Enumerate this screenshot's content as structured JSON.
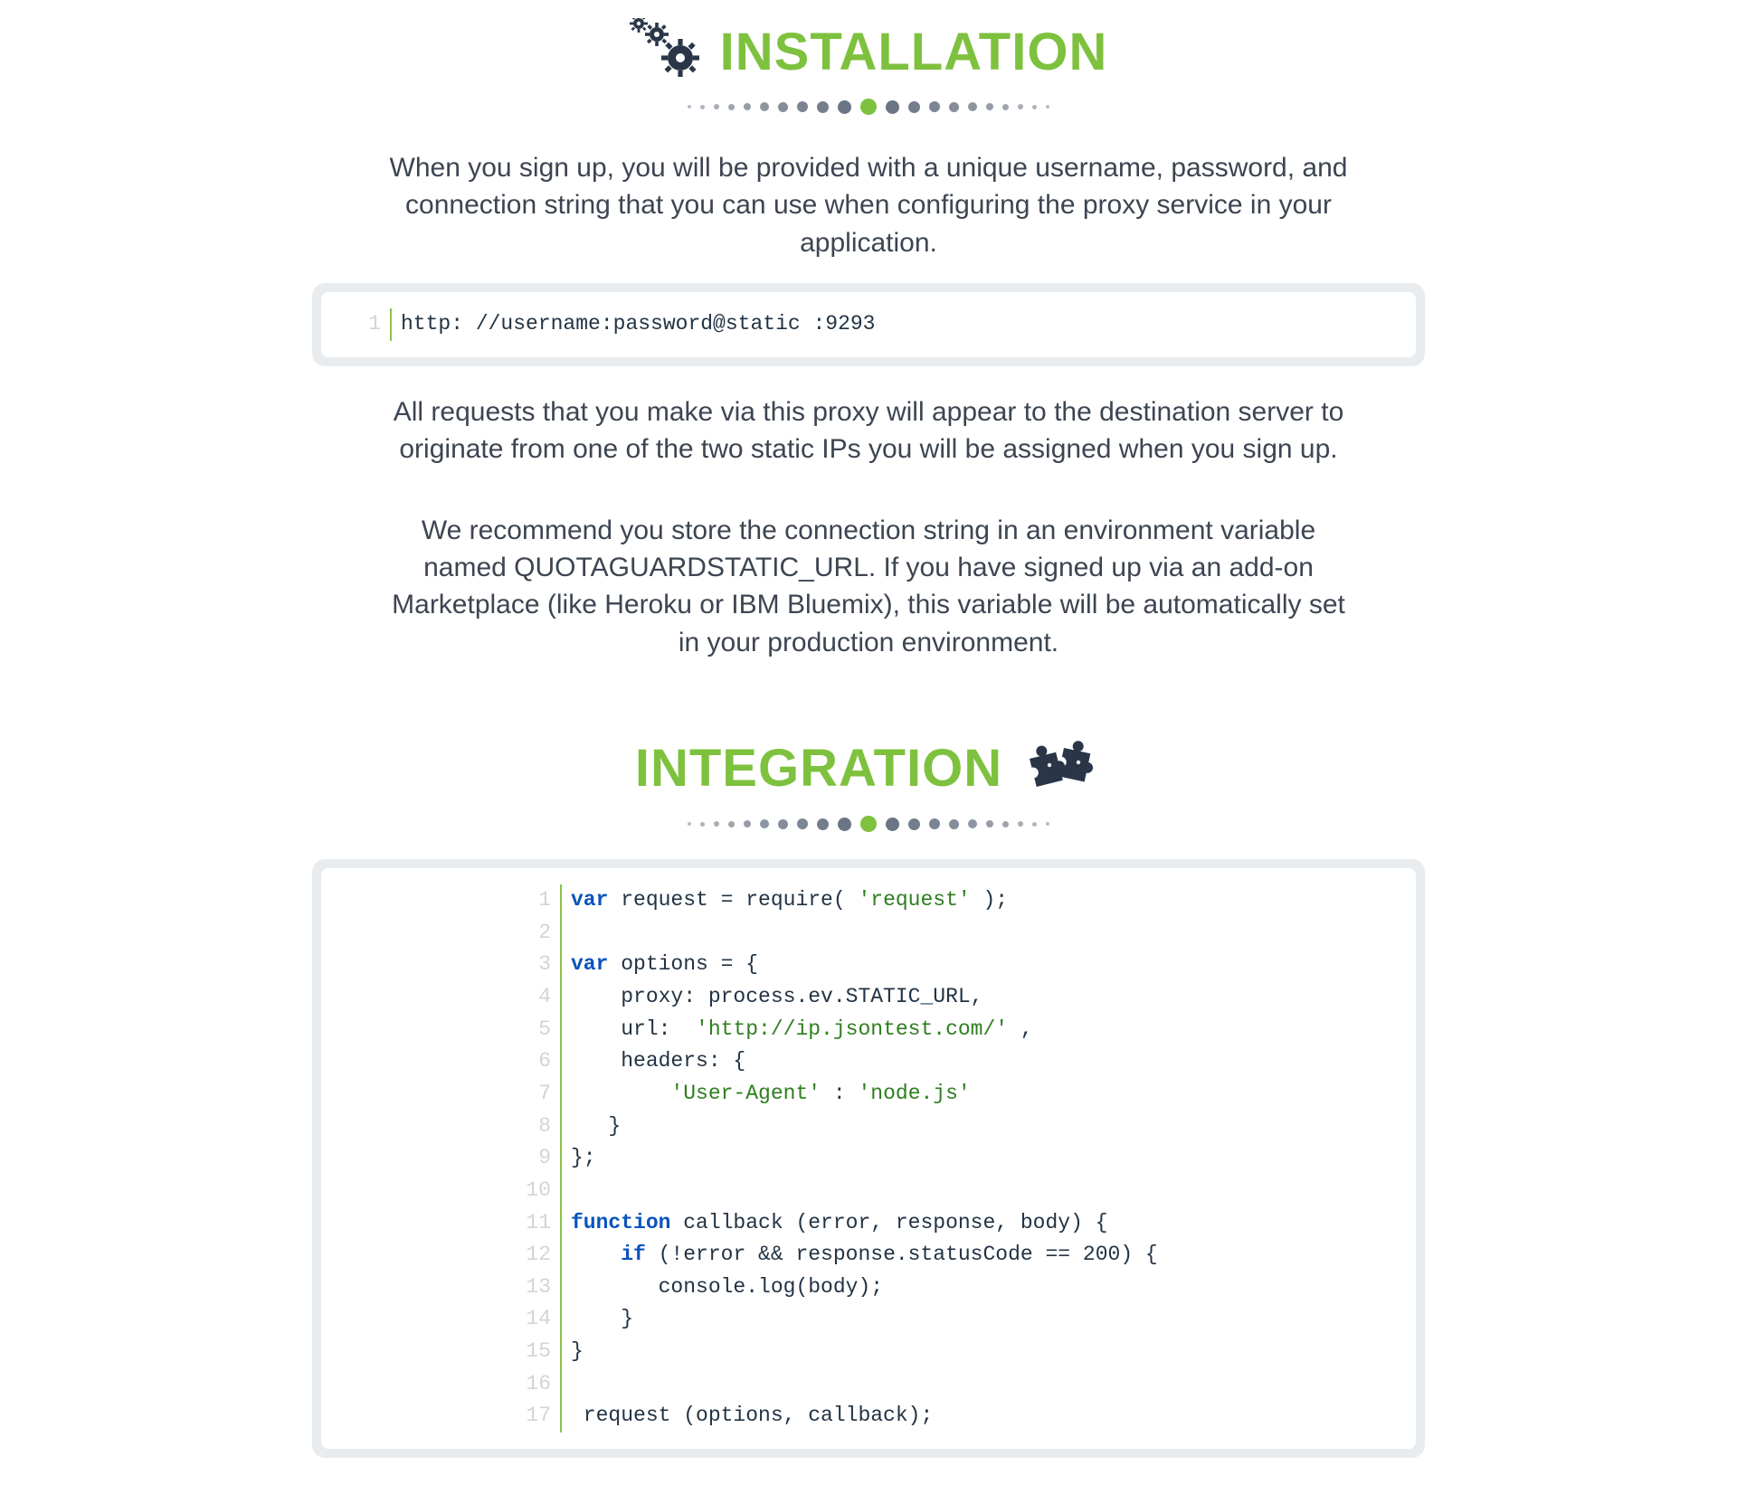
{
  "installation": {
    "title": "INSTALLATION",
    "intro": "When you sign up, you will be provided with a unique username, password, and connection string that you can use when configuring the proxy service in your application.",
    "connection_code": {
      "line_numbers": [
        "1"
      ],
      "lines": [
        "http: //username:password@static :9293"
      ]
    },
    "static_ip_text": "All requests that you make via this proxy will appear to the destination server to originate from one of the two static IPs you will be assigned when you sign up.",
    "env_var_text": "We recommend you store the connection string in an environment variable named QUOTAGUARDSTATIC_URL. If you have signed up via an add-on Marketplace (like Heroku or IBM Bluemix), this variable will be automatically set in your production environment."
  },
  "integration": {
    "title": "INTEGRATION",
    "code": {
      "line_numbers": [
        "1",
        "2",
        "3",
        "4",
        "5",
        "6",
        "7",
        "8",
        "9",
        "10",
        "11",
        "12",
        "13",
        "14",
        "15",
        "16",
        "17"
      ],
      "lines": [
        [
          {
            "t": "kw",
            "v": "var"
          },
          {
            "t": "p",
            "v": " request = require("
          },
          {
            "t": "str",
            "v": " 'request' "
          },
          {
            "t": "p",
            "v": ");"
          }
        ],
        [
          {
            "t": "p",
            "v": ""
          }
        ],
        [
          {
            "t": "kw",
            "v": "var"
          },
          {
            "t": "p",
            "v": " options = {"
          }
        ],
        [
          {
            "t": "p",
            "v": "    proxy: process.ev.STATIC_URL,"
          }
        ],
        [
          {
            "t": "p",
            "v": "    url: "
          },
          {
            "t": "str",
            "v": " 'http://ip.jsontest.com/' "
          },
          {
            "t": "p",
            "v": ","
          }
        ],
        [
          {
            "t": "p",
            "v": "    headers: {"
          }
        ],
        [
          {
            "t": "p",
            "v": "        "
          },
          {
            "t": "str",
            "v": "'User-Agent'"
          },
          {
            "t": "p",
            "v": " : "
          },
          {
            "t": "str",
            "v": "'node.js'"
          }
        ],
        [
          {
            "t": "p",
            "v": "   }"
          }
        ],
        [
          {
            "t": "p",
            "v": "};"
          }
        ],
        [
          {
            "t": "p",
            "v": ""
          }
        ],
        [
          {
            "t": "kw",
            "v": "function"
          },
          {
            "t": "p",
            "v": " callback (error, response, body) {"
          }
        ],
        [
          {
            "t": "p",
            "v": "    "
          },
          {
            "t": "kw",
            "v": "if"
          },
          {
            "t": "p",
            "v": " (!error && response.statusCode == 200) {"
          }
        ],
        [
          {
            "t": "p",
            "v": "       console.log(body);"
          }
        ],
        [
          {
            "t": "p",
            "v": "    }"
          }
        ],
        [
          {
            "t": "p",
            "v": "}"
          }
        ],
        [
          {
            "t": "p",
            "v": ""
          }
        ],
        [
          {
            "t": "p",
            "v": " request (options, callback);"
          }
        ]
      ]
    }
  }
}
